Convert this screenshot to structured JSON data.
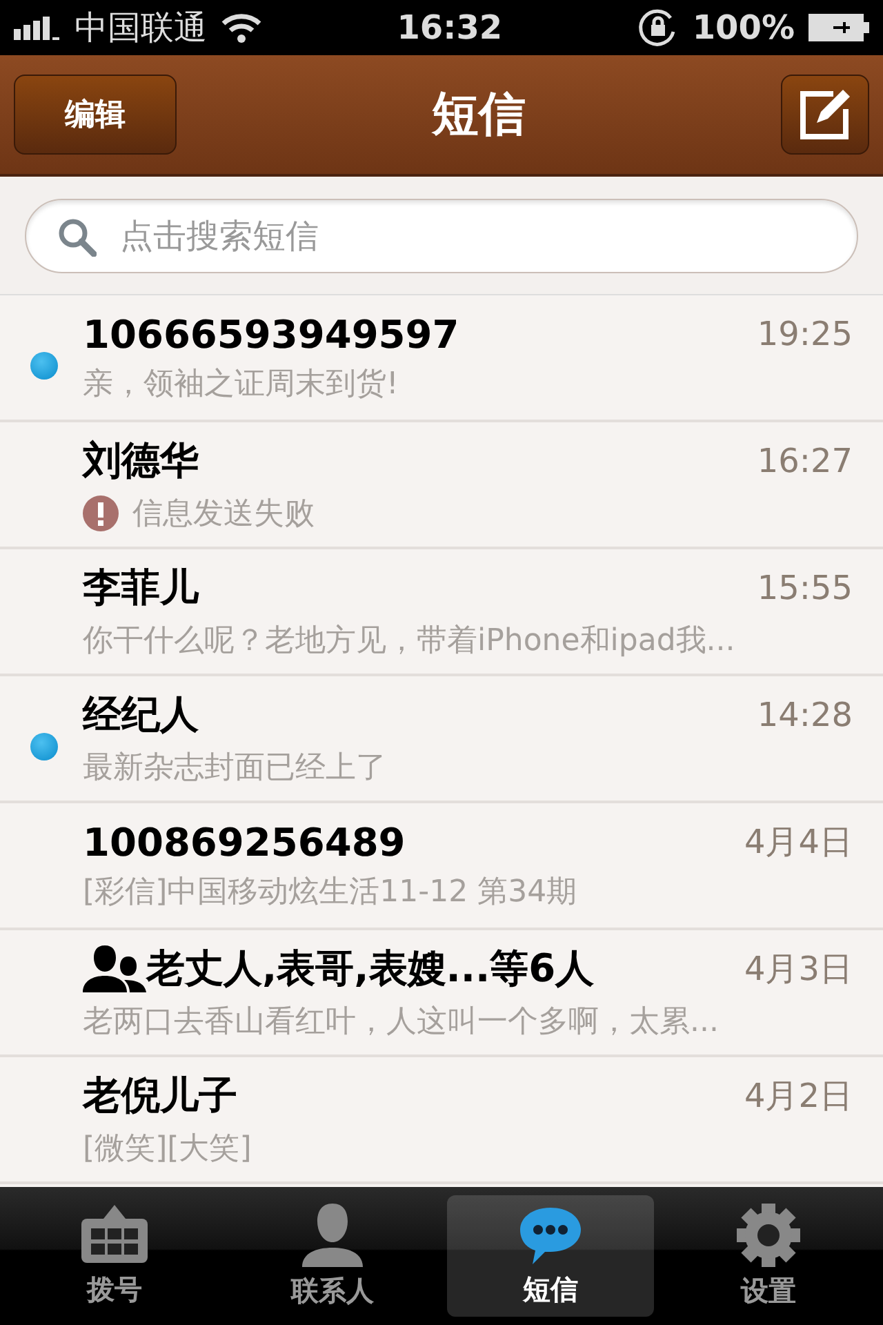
{
  "status_bar": {
    "carrier": "中国联通",
    "time": "16:32",
    "battery": "100%"
  },
  "nav_bar": {
    "edit_button": "编辑",
    "title": "短信"
  },
  "search": {
    "placeholder": "点击搜索短信"
  },
  "messages": [
    {
      "sender": "10666593949597",
      "preview": "亲，领袖之证周末到货!",
      "time": "19:25",
      "unread": true,
      "failed": false,
      "group": false
    },
    {
      "sender": "刘德华",
      "preview": "信息发送失败",
      "time": "16:27",
      "unread": false,
      "failed": true,
      "group": false
    },
    {
      "sender": "李菲儿",
      "preview": "你干什么呢？老地方见，带着iPhone和ipad我...",
      "time": "15:55",
      "unread": false,
      "failed": false,
      "group": false
    },
    {
      "sender": "经纪人",
      "preview": "最新杂志封面已经上了",
      "time": "14:28",
      "unread": true,
      "failed": false,
      "group": false
    },
    {
      "sender": "100869256489",
      "preview": "[彩信]中国移动炫生活11-12 第34期",
      "time": "4月4日",
      "unread": false,
      "failed": false,
      "group": false
    },
    {
      "sender": "老丈人,表哥,表嫂...等6人",
      "preview": "老两口去香山看红叶，人这叫一个多啊，太累...",
      "time": "4月3日",
      "unread": false,
      "failed": false,
      "group": true
    },
    {
      "sender": "老倪儿子",
      "preview": "[微笑][大笑]",
      "time": "4月2日",
      "unread": false,
      "failed": false,
      "group": false
    }
  ],
  "tab_bar": [
    {
      "kind": "dialpad",
      "label": "拨号",
      "selected": false
    },
    {
      "kind": "contacts",
      "label": "联系人",
      "selected": false
    },
    {
      "kind": "messages",
      "label": "短信",
      "selected": true
    },
    {
      "kind": "settings",
      "label": "设置",
      "selected": false
    }
  ]
}
